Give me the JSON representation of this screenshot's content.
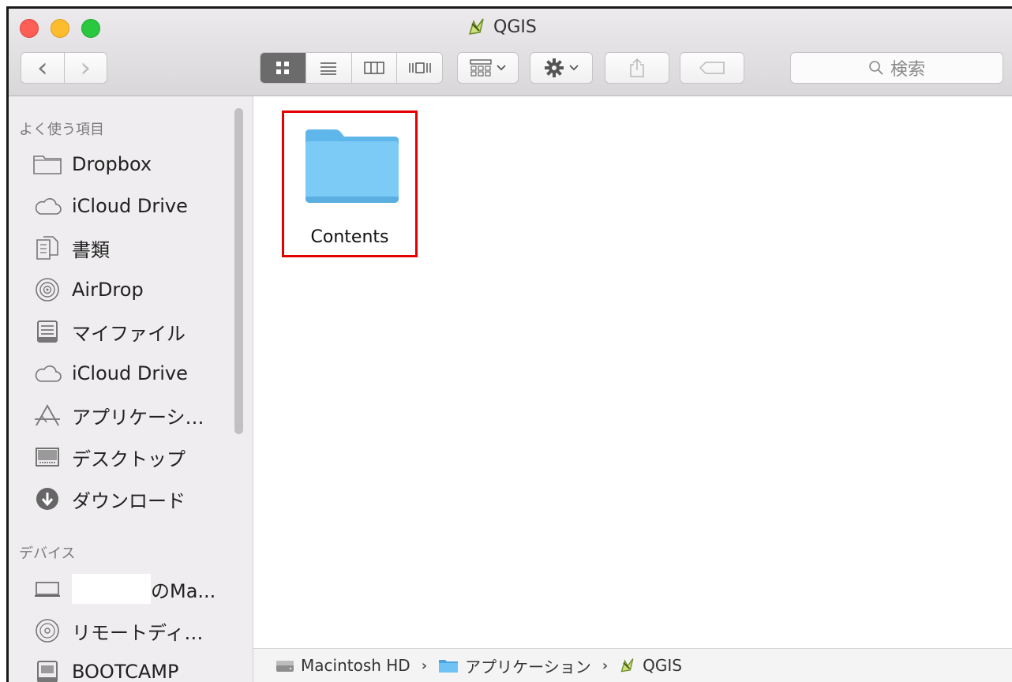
{
  "window": {
    "title": "QGIS"
  },
  "toolbar": {
    "back_glyph": "‹",
    "forward_glyph": "›",
    "search_placeholder": "検索",
    "icons": [
      "back-icon",
      "forward-icon",
      "icon-view-icon",
      "list-view-icon",
      "column-view-icon",
      "cover-flow-icon",
      "arrange-icon",
      "gear-icon",
      "share-icon",
      "tag-icon",
      "search-icon"
    ],
    "active_view": "icon"
  },
  "sidebar": {
    "favorites_header": "よく使う項目",
    "favorites": [
      {
        "label": "Dropbox",
        "icon": "folder-icon"
      },
      {
        "label": "iCloud Drive",
        "icon": "cloud-icon"
      },
      {
        "label": "書類",
        "icon": "documents-icon"
      },
      {
        "label": "AirDrop",
        "icon": "airdrop-icon"
      },
      {
        "label": "マイファイル",
        "icon": "all-files-icon"
      },
      {
        "label": "iCloud Drive",
        "icon": "cloud-icon"
      },
      {
        "label": "アプリケーシ…",
        "icon": "applications-icon"
      },
      {
        "label": "デスクトップ",
        "icon": "desktop-icon"
      },
      {
        "label": "ダウンロード",
        "icon": "downloads-icon"
      }
    ],
    "devices_header": "デバイス",
    "devices": [
      {
        "label": "のMa...",
        "icon": "laptop-icon"
      },
      {
        "label": "リモートディ…",
        "icon": "remote-disc-icon"
      },
      {
        "label": "BOOTCAMP",
        "icon": "drive-icon"
      }
    ]
  },
  "content": {
    "items": [
      {
        "name": "Contents",
        "icon": "folder-icon",
        "highlighted": true
      }
    ]
  },
  "pathbar": {
    "segments": [
      {
        "label": "Macintosh HD",
        "icon": "hard-drive-icon"
      },
      {
        "label": "アプリケーション",
        "icon": "folder-icon"
      },
      {
        "label": "QGIS",
        "icon": "qgis-icon"
      }
    ],
    "separator": "›"
  },
  "colors": {
    "highlight_border": "#e30000",
    "folder_blue": "#6ec3f4",
    "close": "#fd5f57",
    "minimize": "#fdbb2e",
    "zoom": "#29c840"
  }
}
